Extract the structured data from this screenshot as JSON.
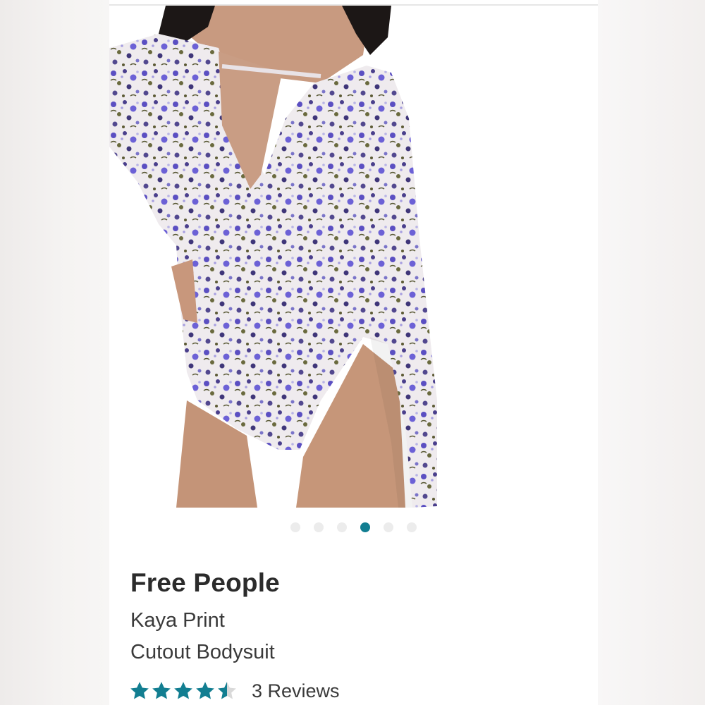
{
  "product": {
    "brand": "Free People",
    "name_line1": "Kaya Print",
    "name_line2": "Cutout Bodysuit",
    "rating": 4.5,
    "rating_max": 5,
    "reviews_label": "3 Reviews"
  },
  "carousel": {
    "total": 6,
    "active_index": 3
  },
  "colors": {
    "accent": "#127e91",
    "star_filled": "#127e91",
    "star_empty": "#d9d9d9",
    "dot_inactive": "#ececec"
  },
  "image": {
    "subject": "model wearing long-sleeve floral cutout bodysuit"
  }
}
